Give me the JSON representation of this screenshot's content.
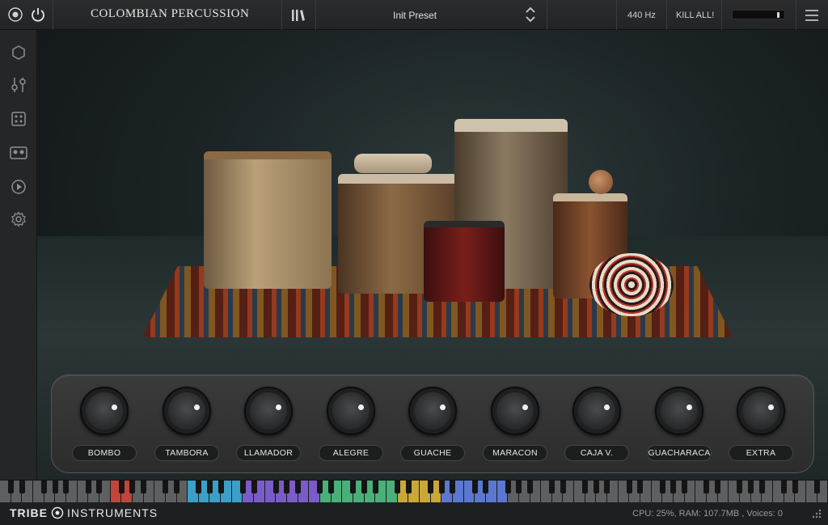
{
  "header": {
    "title": "COLOMBIAN PERCUSSION",
    "preset": "Init Preset",
    "tuning": "440 Hz",
    "kill_all": "KILL ALL!"
  },
  "sidebar": {
    "items": [
      {
        "icon": "hexagon-icon"
      },
      {
        "icon": "sliders-icon"
      },
      {
        "icon": "dice-icon"
      },
      {
        "icon": "tape-icon"
      },
      {
        "icon": "play-icon"
      },
      {
        "icon": "gear-icon"
      }
    ]
  },
  "knobs": [
    {
      "label": "BOMBO"
    },
    {
      "label": "TAMBORA"
    },
    {
      "label": "LLAMADOR"
    },
    {
      "label": "ALEGRE"
    },
    {
      "label": "GUACHE"
    },
    {
      "label": "MARACON"
    },
    {
      "label": "CAJA V."
    },
    {
      "label": "GUACHARACA"
    },
    {
      "label": "EXTRA"
    }
  ],
  "footer": {
    "brand_left": "TRIBE",
    "brand_right": "INSTRUMENTS",
    "status": "CPU: 25%, RAM: 107.7MB , Voices: 0"
  },
  "colors": {
    "background": "#1b1c1d",
    "panel": "#2b2c2b",
    "accent_keys": [
      "#c0453a",
      "#3aa0c8",
      "#7a5cc8",
      "#4ab07a",
      "#c8a83a",
      "#5a78d0"
    ]
  }
}
